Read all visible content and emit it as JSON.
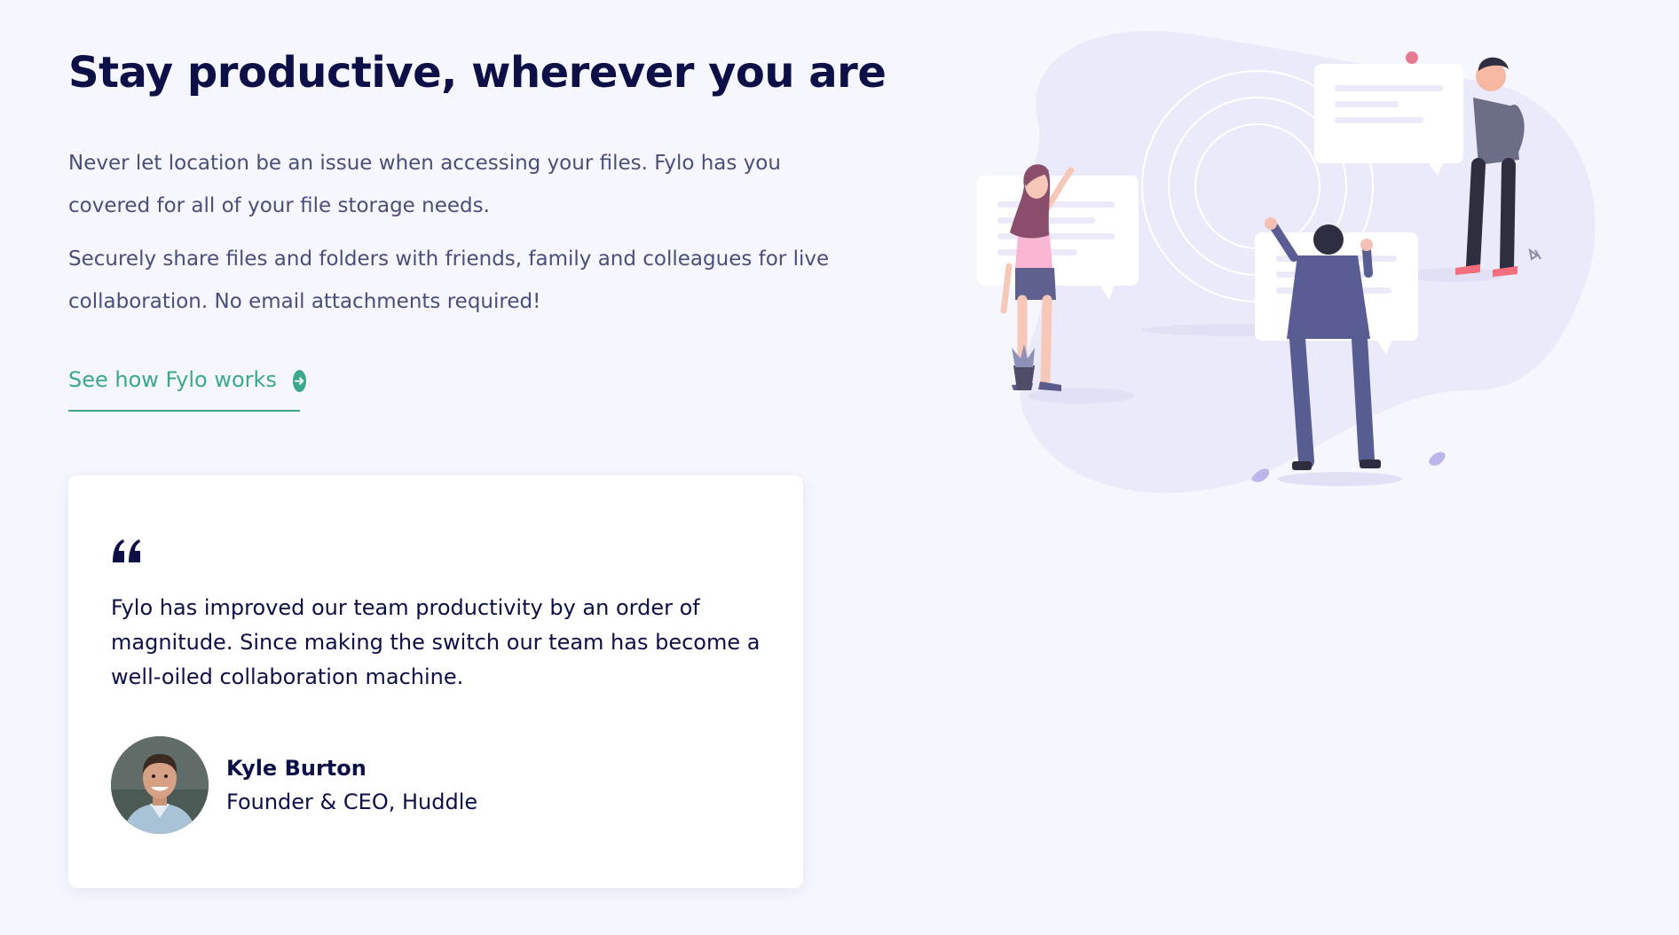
{
  "section": {
    "title": "Stay productive, wherever you are",
    "paragraphs": [
      "Never let location be an issue when accessing your files. Fylo has you covered for all of your file storage needs.",
      "Securely share files and folders with friends, family and colleagues for live collaboration. No email attachments required!"
    ],
    "cta": {
      "label": "See how Fylo works",
      "icon": "arrow-right-circle-icon"
    }
  },
  "testimonial": {
    "quote_icon": "quotation-mark-icon",
    "quote": "Fylo has improved our team productivity by an order of magnitude. Since making the switch our team has become a well-oiled collaboration machine.",
    "author": {
      "name": "Kyle Burton",
      "role": "Founder & CEO, Huddle"
    }
  },
  "colors": {
    "background": "#f5f6fe",
    "heading": "#0c1047",
    "body_text": "#4a4f7a",
    "accent": "#3ba88b",
    "card": "#ffffff"
  }
}
